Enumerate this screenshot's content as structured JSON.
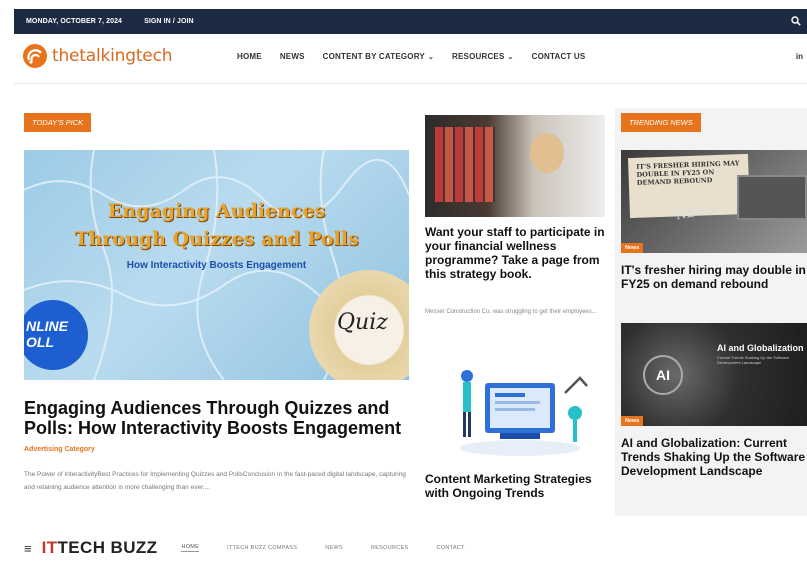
{
  "topbar": {
    "date": "MONDAY, OCTOBER 7, 2024",
    "signin": "SIGN IN / JOIN"
  },
  "header": {
    "logo_text": "thetalkingtech",
    "nav": [
      {
        "label": "HOME"
      },
      {
        "label": "NEWS"
      },
      {
        "label": "CONTENT BY CATEGORY",
        "dropdown": true
      },
      {
        "label": "RESOURCES",
        "dropdown": true
      },
      {
        "label": "CONTACT US"
      }
    ],
    "social": "in"
  },
  "left": {
    "tag": "TODAY'S PICK",
    "image_text": {
      "line1": "Engaging Audiences",
      "line2": "Through Quizzes and Polls",
      "line3": "How Interactivity Boosts Engagement",
      "badge": "NLINE OLL",
      "quiz": "Quiz"
    },
    "title": "Engaging Audiences Through Quizzes and Polls: How Interactivity Boosts Engagement",
    "category": "Advertising Category",
    "excerpt": "The Power of InteractivityBest Practices for Implementing Quizzes and PollsConclusion In the fast-paced digital landscape, capturing and retaining audience attention is more challenging than ever...."
  },
  "middle": {
    "title1": "Want your staff to participate in your financial wellness programme? Take a page from this strategy book.",
    "excerpt1": "Messer Construction Co. was struggling to get their employees...",
    "title2": "Content Marketing Strategies with Ongoing Trends"
  },
  "right": {
    "tag": "TRENDING NEWS",
    "card1": {
      "image_text": "IT'S FRESHER HIRING MAY DOUBLE IN FY25 ON DEMAND REBOUND",
      "image_word": "NEWS",
      "badge": "News",
      "title": "IT's fresher hiring may double in FY25 on demand rebound"
    },
    "card2": {
      "image_ai": "AI",
      "image_label": "AI and Globalization",
      "image_sub": "Current Trends Shaking Up the Software Development Landscape",
      "badge": "News",
      "title": "AI and Globalization: Current Trends Shaking Up the Software Development Landscape"
    }
  },
  "bottom": {
    "brand_a": "IT",
    "brand_b": "TECH BUZZ",
    "nav": [
      "HOME",
      "ITTECH BUZZ COMPASS",
      "NEWS",
      "RESOURCES",
      "CONTACT"
    ]
  },
  "colors": {
    "topbar": "#1c2a44",
    "accent": "#e8731d"
  }
}
